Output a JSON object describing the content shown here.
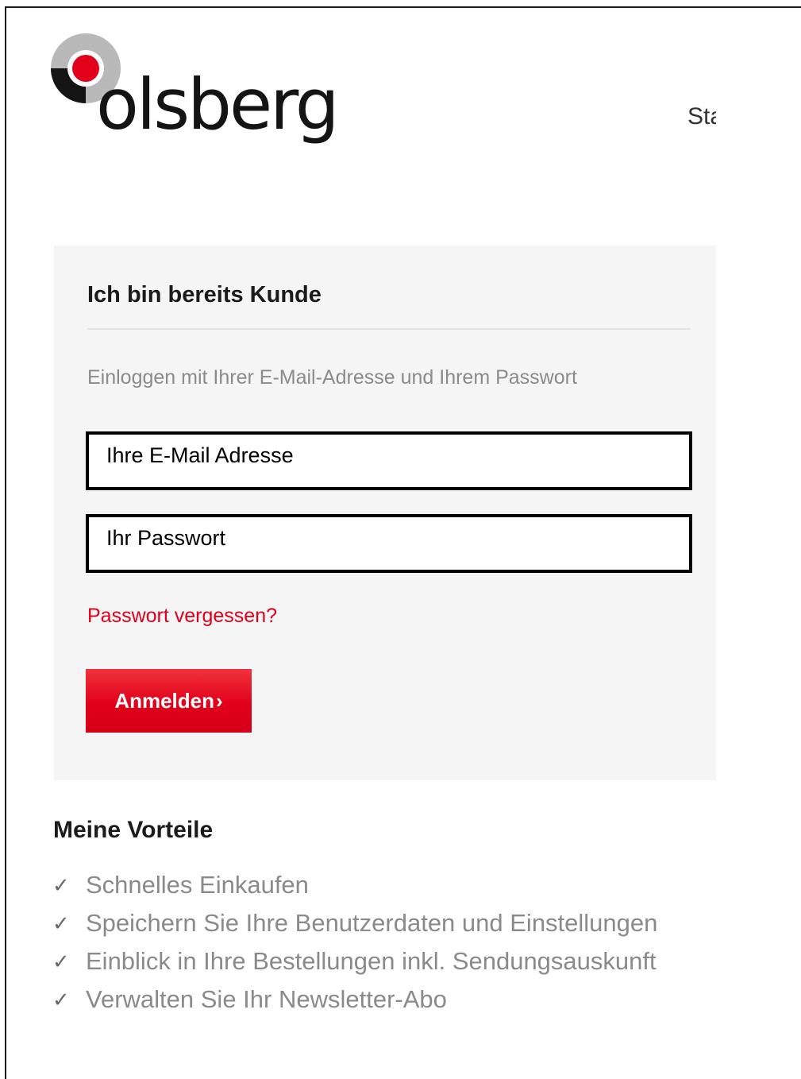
{
  "brand": {
    "name": "olsberg",
    "accent_red": "#e2001a",
    "logo_icon": "olsberg-logo-mark"
  },
  "header": {
    "nav_partial": "Sta"
  },
  "login": {
    "title": "Ich bin bereits Kunde",
    "subtitle": "Einloggen mit Ihrer E-Mail-Adresse und Ihrem Passwort",
    "email_placeholder": "Ihre E-Mail Adresse",
    "password_placeholder": "Ihr Passwort",
    "forgot_link": "Passwort vergessen?",
    "submit_label": "Anmelden",
    "submit_icon": "chevron-right"
  },
  "benefits": {
    "title": "Meine Vorteile",
    "check_icon": "checkmark",
    "items": [
      "Schnelles Einkaufen",
      "Speichern Sie Ihre Benutzerdaten und Einstellungen",
      "Einblick in Ihre Bestellungen inkl. Sendungsauskunft",
      "Verwalten Sie Ihr Newsletter-Abo"
    ]
  }
}
